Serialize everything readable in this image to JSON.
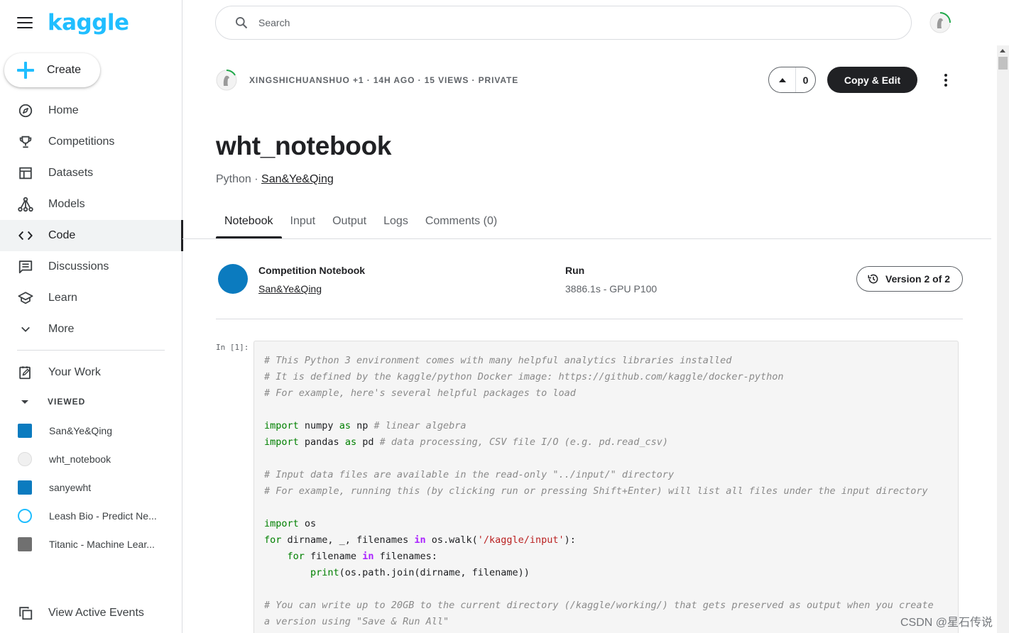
{
  "sidebar": {
    "logo": "kaggle",
    "create_label": "Create",
    "nav": [
      {
        "label": "Home",
        "icon": "compass-icon"
      },
      {
        "label": "Competitions",
        "icon": "trophy-icon"
      },
      {
        "label": "Datasets",
        "icon": "table-icon"
      },
      {
        "label": "Models",
        "icon": "models-icon"
      },
      {
        "label": "Code",
        "icon": "code-icon"
      },
      {
        "label": "Discussions",
        "icon": "discussion-icon"
      },
      {
        "label": "Learn",
        "icon": "school-icon"
      },
      {
        "label": "More",
        "icon": "chevron-down-icon"
      }
    ],
    "active_item": "Code",
    "your_work": "Your Work",
    "viewed_label": "VIEWED",
    "viewed": [
      {
        "label": "San&Ye&Qing",
        "thumb_color": "#0b7bbf"
      },
      {
        "label": "wht_notebook",
        "thumb_color": "#e8e8e8"
      },
      {
        "label": "sanyewht",
        "thumb_color": "#0b7bbf"
      },
      {
        "label": "Leash Bio - Predict Ne...",
        "thumb_color": "#20beff"
      },
      {
        "label": "Titanic - Machine Lear...",
        "thumb_color": "#707070"
      }
    ],
    "active_events": "View Active Events"
  },
  "search": {
    "placeholder": "Search"
  },
  "header": {
    "meta": "XINGSHICHUANSHUO +1 · 14H AGO · 15 VIEWS · PRIVATE",
    "vote_count": "0",
    "copy_edit": "Copy & Edit"
  },
  "notebook": {
    "title": "wht_notebook",
    "language": "Python",
    "separator": " · ",
    "owner": "San&Ye&Qing",
    "tabs": [
      "Notebook",
      "Input",
      "Output",
      "Logs",
      "Comments (0)"
    ],
    "active_tab": "Notebook",
    "info_title": "Competition Notebook",
    "info_author": "San&Ye&Qing",
    "run_label": "Run",
    "run_value": "3886.1s - GPU P100",
    "version": "Version 2 of 2",
    "prompt": "In [1]:"
  },
  "code_lines": [
    "# This Python 3 environment comes with many helpful analytics libraries installed",
    "# It is defined by the kaggle/python Docker image: https://github.com/kaggle/docker-python",
    "# For example, here's several helpful packages to load",
    "",
    "import numpy as np # linear algebra",
    "import pandas as pd # data processing, CSV file I/O (e.g. pd.read_csv)",
    "",
    "# Input data files are available in the read-only \"../input/\" directory",
    "# For example, running this (by clicking run or pressing Shift+Enter) will list all files under the input directory",
    "",
    "import os",
    "for dirname, _, filenames in os.walk('/kaggle/input'):",
    "    for filename in filenames:",
    "        print(os.path.join(dirname, filename))",
    "",
    "# You can write up to 20GB to the current directory (/kaggle/working/) that gets preserved as output when you create",
    "a version using \"Save & Run All\""
  ],
  "watermark": "CSDN @星石传说",
  "colors": {
    "accent": "#20beff",
    "primary_button": "#202124",
    "avatar_blue": "#0b7bbf"
  }
}
